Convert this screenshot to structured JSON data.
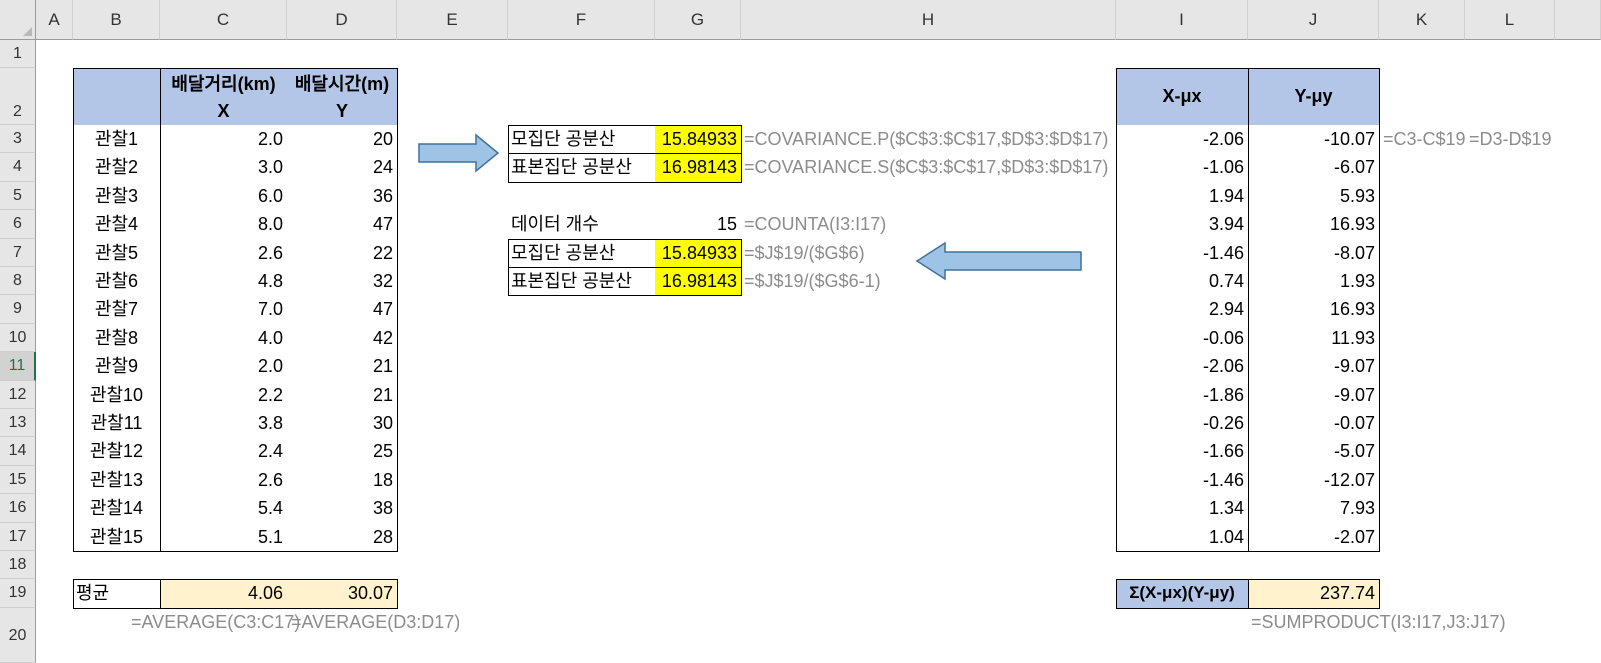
{
  "columns": [
    "A",
    "B",
    "C",
    "D",
    "E",
    "F",
    "G",
    "H",
    "I",
    "J",
    "K",
    "L"
  ],
  "rows": [
    "1",
    "2",
    "3",
    "4",
    "5",
    "6",
    "7",
    "8",
    "9",
    "10",
    "11",
    "12",
    "13",
    "14",
    "15",
    "16",
    "17",
    "18",
    "19",
    "20"
  ],
  "active_row": "11",
  "table1": {
    "header_c": "배달거리(km)",
    "header_d": "배달시간(m)",
    "sub_c": "X",
    "sub_d": "Y",
    "rows": [
      {
        "label": "관찰1",
        "x": "2.0",
        "y": "20"
      },
      {
        "label": "관찰2",
        "x": "3.0",
        "y": "24"
      },
      {
        "label": "관찰3",
        "x": "6.0",
        "y": "36"
      },
      {
        "label": "관찰4",
        "x": "8.0",
        "y": "47"
      },
      {
        "label": "관찰5",
        "x": "2.6",
        "y": "22"
      },
      {
        "label": "관찰6",
        "x": "4.8",
        "y": "32"
      },
      {
        "label": "관찰7",
        "x": "7.0",
        "y": "47"
      },
      {
        "label": "관찰8",
        "x": "4.0",
        "y": "42"
      },
      {
        "label": "관찰9",
        "x": "2.0",
        "y": "21"
      },
      {
        "label": "관찰10",
        "x": "2.2",
        "y": "21"
      },
      {
        "label": "관찰11",
        "x": "3.8",
        "y": "30"
      },
      {
        "label": "관찰12",
        "x": "2.4",
        "y": "25"
      },
      {
        "label": "관찰13",
        "x": "2.6",
        "y": "18"
      },
      {
        "label": "관찰14",
        "x": "5.4",
        "y": "38"
      },
      {
        "label": "관찰15",
        "x": "5.1",
        "y": "28"
      }
    ],
    "avg_label": "평균",
    "avg_x": "4.06",
    "avg_y": "30.07",
    "formula_avg_x": "=AVERAGE(C3:C17)",
    "formula_avg_y": "=AVERAGE(D3:D17)"
  },
  "cov1": {
    "pop_label": "모집단 공분산",
    "pop_value": "15.84933",
    "pop_formula": "=COVARIANCE.P($C$3:$C$17,$D$3:$D$17)",
    "sample_label": "표본집단 공분산",
    "sample_value": "16.98143",
    "sample_formula": "=COVARIANCE.S($C$3:$C$17,$D$3:$D$17)"
  },
  "cov2": {
    "count_label": "데이터 개수",
    "count_value": "15",
    "count_formula": "=COUNTA(I3:I17)",
    "pop_label": "모집단 공분산",
    "pop_value": "15.84933",
    "pop_formula": "=$J$19/($G$6)",
    "sample_label": "표본집단 공분산",
    "sample_value": "16.98143",
    "sample_formula": "=$J$19/($G$6-1)"
  },
  "table2": {
    "header_i": "X-μx",
    "header_j": "Y-μy",
    "formula_i": "=C3-C$19",
    "formula_j": "=D3-D$19",
    "rows": [
      {
        "dx": "-2.06",
        "dy": "-10.07"
      },
      {
        "dx": "-1.06",
        "dy": "-6.07"
      },
      {
        "dx": "1.94",
        "dy": "5.93"
      },
      {
        "dx": "3.94",
        "dy": "16.93"
      },
      {
        "dx": "-1.46",
        "dy": "-8.07"
      },
      {
        "dx": "0.74",
        "dy": "1.93"
      },
      {
        "dx": "2.94",
        "dy": "16.93"
      },
      {
        "dx": "-0.06",
        "dy": "11.93"
      },
      {
        "dx": "-2.06",
        "dy": "-9.07"
      },
      {
        "dx": "-1.86",
        "dy": "-9.07"
      },
      {
        "dx": "-0.26",
        "dy": "-0.07"
      },
      {
        "dx": "-1.66",
        "dy": "-5.07"
      },
      {
        "dx": "-1.46",
        "dy": "-12.07"
      },
      {
        "dx": "1.34",
        "dy": "7.93"
      },
      {
        "dx": "1.04",
        "dy": "-2.07"
      }
    ],
    "sum_label": "Σ(X-μx)(Y-μy)",
    "sum_value": "237.74",
    "sum_formula": "=SUMPRODUCT(I3:I17,J3:J17)"
  },
  "colors": {
    "header_fill": "#b4c6e7",
    "highlight": "#ffff00",
    "avg_fill": "#fff2cc",
    "arrow_fill": "#9dc3e6",
    "arrow_stroke": "#41719c"
  }
}
